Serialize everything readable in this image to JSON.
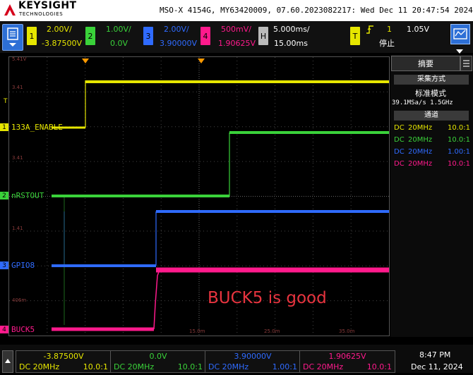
{
  "header": {
    "brand": "KEYSIGHT",
    "subbrand": "TECHNOLOGIES",
    "info": "MSO-X 4154G, MY63420009, 07.60.2023082217: Wed Dec 11 20:47:54 2024"
  },
  "channels": [
    {
      "num": "1",
      "scale": "2.00V/",
      "offset": "-3.87500V",
      "color": "#e6e600"
    },
    {
      "num": "2",
      "scale": "1.00V/",
      "offset": "0.0V",
      "color": "#3ad23a"
    },
    {
      "num": "3",
      "scale": "2.00V/",
      "offset": "3.90000V",
      "color": "#2f6bff"
    },
    {
      "num": "4",
      "scale": "500mV/",
      "offset": "1.90625V",
      "color": "#ff1a8c"
    }
  ],
  "horizontal": {
    "label": "H",
    "scale": "5.000ms/",
    "delay": "15.00ms"
  },
  "trigger": {
    "label": "T",
    "source": "1",
    "level": "1.05V",
    "state": "停止"
  },
  "waveform_labels": {
    "ch1": "133A_ENABLE",
    "ch2": "nRSTOUT",
    "ch3": "GPIO8",
    "ch4": "BUCK5",
    "annotation": "BUCK5 is good"
  },
  "grid_labels": {
    "l1": "5.41V",
    "l2": "3.41",
    "l3": "3.41",
    "l4": "1.41",
    "l5": "406m",
    "t1": "15.0m",
    "t2": "25.0m",
    "t3": "35.0m"
  },
  "panel": {
    "title": "摘要",
    "acq_title": "采集方式",
    "acq_mode": "标准模式",
    "rate": "39.1MSa/s  1.5GHz",
    "chan_title": "通道",
    "rows": [
      {
        "coupling": "DC",
        "bw": "20MHz",
        "probe": "10.0:1",
        "color": "#e6e600"
      },
      {
        "coupling": "DC",
        "bw": "20MHz",
        "probe": "10.0:1",
        "color": "#3ad23a"
      },
      {
        "coupling": "DC",
        "bw": "20MHz",
        "probe": "1.00:1",
        "color": "#2f6bff"
      },
      {
        "coupling": "DC",
        "bw": "20MHz",
        "probe": "10.0:1",
        "color": "#ff1a8c"
      }
    ]
  },
  "bottom": {
    "cells": [
      {
        "value": "-3.87500V",
        "coupling": "DC 20MHz",
        "probe": "10.0:1",
        "color": "#e6e600"
      },
      {
        "value": "0.0V",
        "coupling": "DC 20MHz",
        "probe": "10.0:1",
        "color": "#3ad23a"
      },
      {
        "value": "3.90000V",
        "coupling": "DC 20MHz",
        "probe": "1.00:1",
        "color": "#2f6bff"
      },
      {
        "value": "1.90625V",
        "coupling": "DC 20MHz",
        "probe": "10.0:1",
        "color": "#ff1a8c"
      }
    ],
    "time": "8:47 PM",
    "date": "Dec 11, 2024"
  }
}
